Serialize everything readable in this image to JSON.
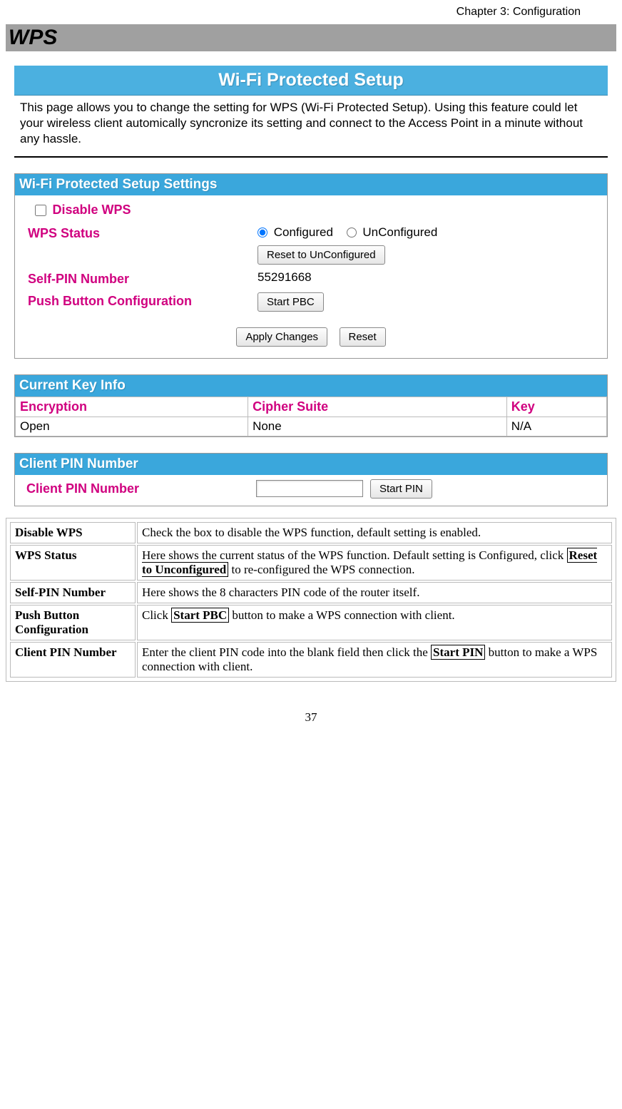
{
  "chapter_header": "Chapter 3: Configuration",
  "section_title": "WPS",
  "banner_title": "Wi-Fi Protected Setup",
  "intro_text": "This page allows you to change the setting for WPS (Wi-Fi Protected Setup). Using this feature could let your wireless client automically syncronize its setting and connect to the Access Point in a minute without any hassle.",
  "settings": {
    "panel_header": "Wi-Fi Protected Setup Settings",
    "disable_label": "Disable WPS",
    "status_label": "WPS Status",
    "status_options": {
      "configured": "Configured",
      "unconfigured": "UnConfigured"
    },
    "reset_btn": "Reset to UnConfigured",
    "selfpin_label": "Self-PIN Number",
    "selfpin_value": "55291668",
    "pbc_label": "Push Button Configuration",
    "pbc_btn": "Start PBC",
    "apply_btn": "Apply Changes",
    "resetform_btn": "Reset"
  },
  "keyinfo": {
    "panel_header": "Current Key Info",
    "headers": {
      "enc": "Encryption",
      "cipher": "Cipher Suite",
      "key": "Key"
    },
    "row": {
      "enc": "Open",
      "cipher": "None",
      "key": "N/A"
    }
  },
  "clientpin": {
    "panel_header": "Client PIN Number",
    "label": "Client PIN Number",
    "btn": "Start PIN"
  },
  "help": {
    "rows": [
      {
        "term": "Disable WPS",
        "desc": "Check the box to disable the WPS function, default setting is enabled."
      },
      {
        "term": "WPS Status",
        "desc_pre": "Here shows the current status of the WPS function. Default setting is Configured, click ",
        "desc_boxed": "Reset to Unconfigured",
        "desc_post": " to re-configured the WPS connection."
      },
      {
        "term": "Self-PIN Number",
        "desc": "Here shows the 8 characters PIN code of the router itself."
      },
      {
        "term": "Push Button Configuration",
        "desc_pre": "Click ",
        "desc_boxed": "Start PBC",
        "desc_post": " button to make a WPS connection with client."
      },
      {
        "term": "Client PIN Number",
        "desc_pre": "Enter the client PIN code into the blank field then click the ",
        "desc_boxed": "Start PIN",
        "desc_post": " button to make a WPS connection with client."
      }
    ]
  },
  "page_number": "37"
}
